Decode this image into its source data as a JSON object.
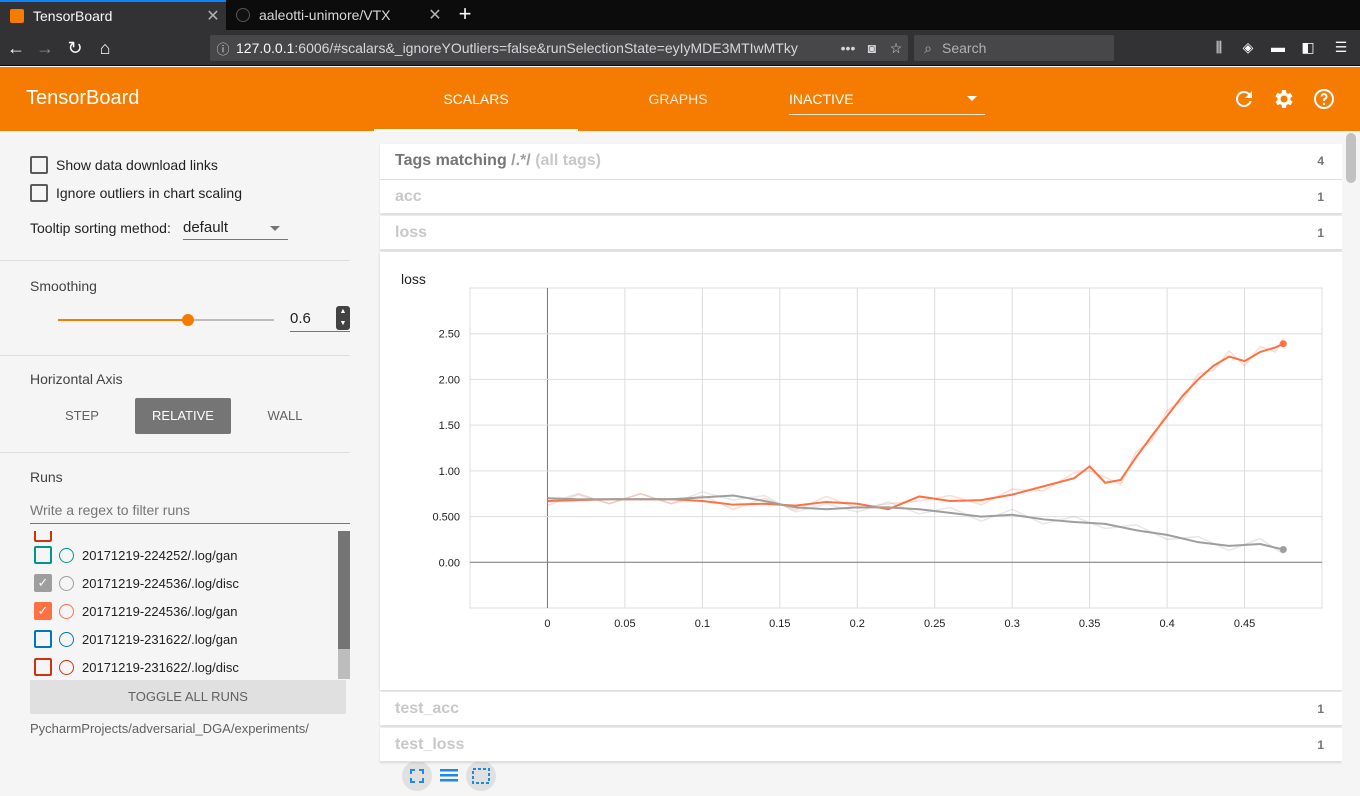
{
  "browser": {
    "tabs": [
      {
        "title": "TensorBoard",
        "active": true
      },
      {
        "title": "aaleotti-unimore/VTX",
        "active": false
      }
    ],
    "url_host": "127.0.0.1",
    "url_rest": ":6006/#scalars&_ignoreYOutliers=false&runSelectionState=eyIyMDE3MTIwMTky",
    "search_placeholder": "Search"
  },
  "header": {
    "logo": "TensorBoard",
    "tabs": [
      "SCALARS",
      "GRAPHS"
    ],
    "inactive_select": "INACTIVE",
    "accent_color": "#f57c00"
  },
  "sidebar": {
    "show_download": "Show data download links",
    "ignore_outliers": "Ignore outliers in chart scaling",
    "tooltip_label": "Tooltip sorting method:",
    "tooltip_value": "default",
    "smoothing_label": "Smoothing",
    "smoothing_value": "0.6",
    "smoothing_fraction": 0.6,
    "axis_label": "Horizontal Axis",
    "axis_options": [
      "STEP",
      "RELATIVE",
      "WALL"
    ],
    "axis_selected": "RELATIVE",
    "runs_label": "Runs",
    "runs_filter_placeholder": "Write a regex to filter runs",
    "runs": [
      {
        "name": "20171219-224252/.log/gan",
        "checked": false,
        "color": "#009688"
      },
      {
        "name": "20171219-224536/.log/disc",
        "checked": true,
        "color": "#9e9e9e"
      },
      {
        "name": "20171219-224536/.log/gan",
        "checked": true,
        "color": "#ff7043"
      },
      {
        "name": "20171219-231622/.log/gan",
        "checked": false,
        "color": "#0077bb"
      },
      {
        "name": "20171219-231622/.log/disc",
        "checked": false,
        "color": "#cc3311"
      }
    ],
    "toggle_all": "TOGGLE ALL RUNS",
    "logdir": "PycharmProjects/adversarial_DGA/experiments/"
  },
  "main": {
    "tags_header": "Tags matching",
    "tags_regex": "/.*/",
    "tags_all": "(all tags)",
    "tags_count": "4",
    "panes": [
      {
        "name": "acc",
        "count": "1"
      },
      {
        "name": "loss",
        "count": "1"
      },
      {
        "name": "test_acc",
        "count": "1"
      },
      {
        "name": "test_loss",
        "count": "1"
      }
    ],
    "card_title": "loss"
  },
  "chart_data": {
    "type": "line",
    "title": "loss",
    "xlim": [
      -0.05,
      0.5
    ],
    "ylim": [
      -0.5,
      3.0
    ],
    "xticks": [
      "0",
      "0.05",
      "0.1",
      "0.15",
      "0.2",
      "0.25",
      "0.3",
      "0.35",
      "0.4",
      "0.45"
    ],
    "yticks": [
      "0.00",
      "0.500",
      "1.00",
      "1.50",
      "2.00",
      "2.50"
    ],
    "grid": true,
    "series": [
      {
        "color": "#ff7043",
        "x": [
          0,
          0.02,
          0.04,
          0.06,
          0.08,
          0.1,
          0.12,
          0.14,
          0.16,
          0.18,
          0.2,
          0.22,
          0.24,
          0.26,
          0.28,
          0.3,
          0.32,
          0.34,
          0.35,
          0.36,
          0.37,
          0.38,
          0.39,
          0.4,
          0.41,
          0.42,
          0.43,
          0.44,
          0.45,
          0.46,
          0.47,
          0.475
        ],
        "y": [
          0.67,
          0.68,
          0.69,
          0.69,
          0.69,
          0.67,
          0.63,
          0.64,
          0.62,
          0.66,
          0.64,
          0.58,
          0.72,
          0.67,
          0.68,
          0.74,
          0.83,
          0.92,
          1.05,
          0.87,
          0.9,
          1.15,
          1.38,
          1.6,
          1.82,
          2.0,
          2.15,
          2.25,
          2.2,
          2.3,
          2.35,
          2.39
        ]
      },
      {
        "color": "#9e9e9e",
        "x": [
          0,
          0.02,
          0.04,
          0.06,
          0.08,
          0.1,
          0.12,
          0.14,
          0.16,
          0.18,
          0.2,
          0.22,
          0.24,
          0.26,
          0.28,
          0.3,
          0.32,
          0.34,
          0.36,
          0.38,
          0.4,
          0.42,
          0.44,
          0.46,
          0.475
        ],
        "y": [
          0.7,
          0.69,
          0.69,
          0.69,
          0.69,
          0.71,
          0.73,
          0.67,
          0.6,
          0.58,
          0.6,
          0.6,
          0.58,
          0.54,
          0.5,
          0.52,
          0.47,
          0.44,
          0.42,
          0.35,
          0.3,
          0.22,
          0.18,
          0.2,
          0.14
        ]
      }
    ]
  }
}
